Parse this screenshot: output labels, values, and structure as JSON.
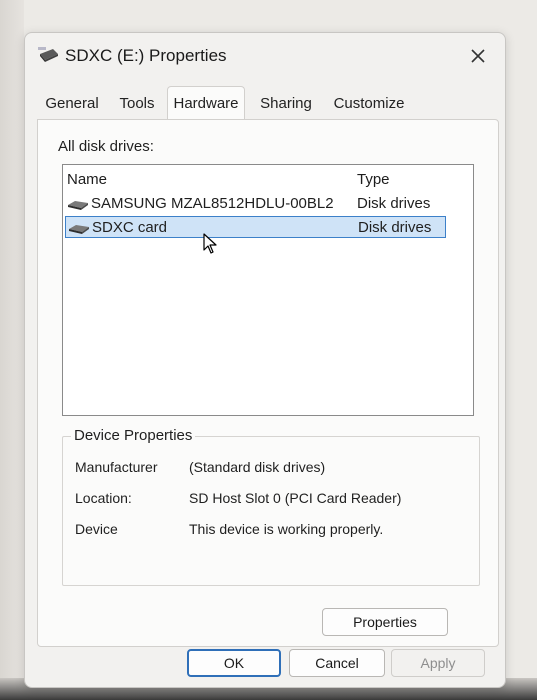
{
  "window": {
    "title": "SDXC (E:) Properties"
  },
  "tabs": [
    {
      "label": "General"
    },
    {
      "label": "Tools"
    },
    {
      "label": "Hardware"
    },
    {
      "label": "Sharing"
    },
    {
      "label": "Customize"
    }
  ],
  "active_tab": "Hardware",
  "hardware": {
    "list_label": "All disk drives:",
    "columns": {
      "name": "Name",
      "type": "Type"
    },
    "rows": [
      {
        "name": "SAMSUNG MZAL8512HDLU-00BL2",
        "type": "Disk drives"
      },
      {
        "name": "SDXC card",
        "type": "Disk drives"
      }
    ],
    "selected_row": 1
  },
  "device_properties": {
    "title": "Device Properties",
    "items": [
      {
        "label": "Manufacturer",
        "value": "(Standard disk drives)"
      },
      {
        "label": "Location:",
        "value": "SD Host Slot 0 (PCI Card Reader)"
      },
      {
        "label": "Device",
        "value": "This device is working properly."
      }
    ],
    "properties_button": "Properties"
  },
  "buttons": {
    "ok": "OK",
    "cancel": "Cancel",
    "apply": "Apply"
  },
  "icons": {
    "title": "drive-icon",
    "close": "close-icon",
    "row": "disk-drive-icon",
    "cursor": "mouse-cursor-icon"
  }
}
